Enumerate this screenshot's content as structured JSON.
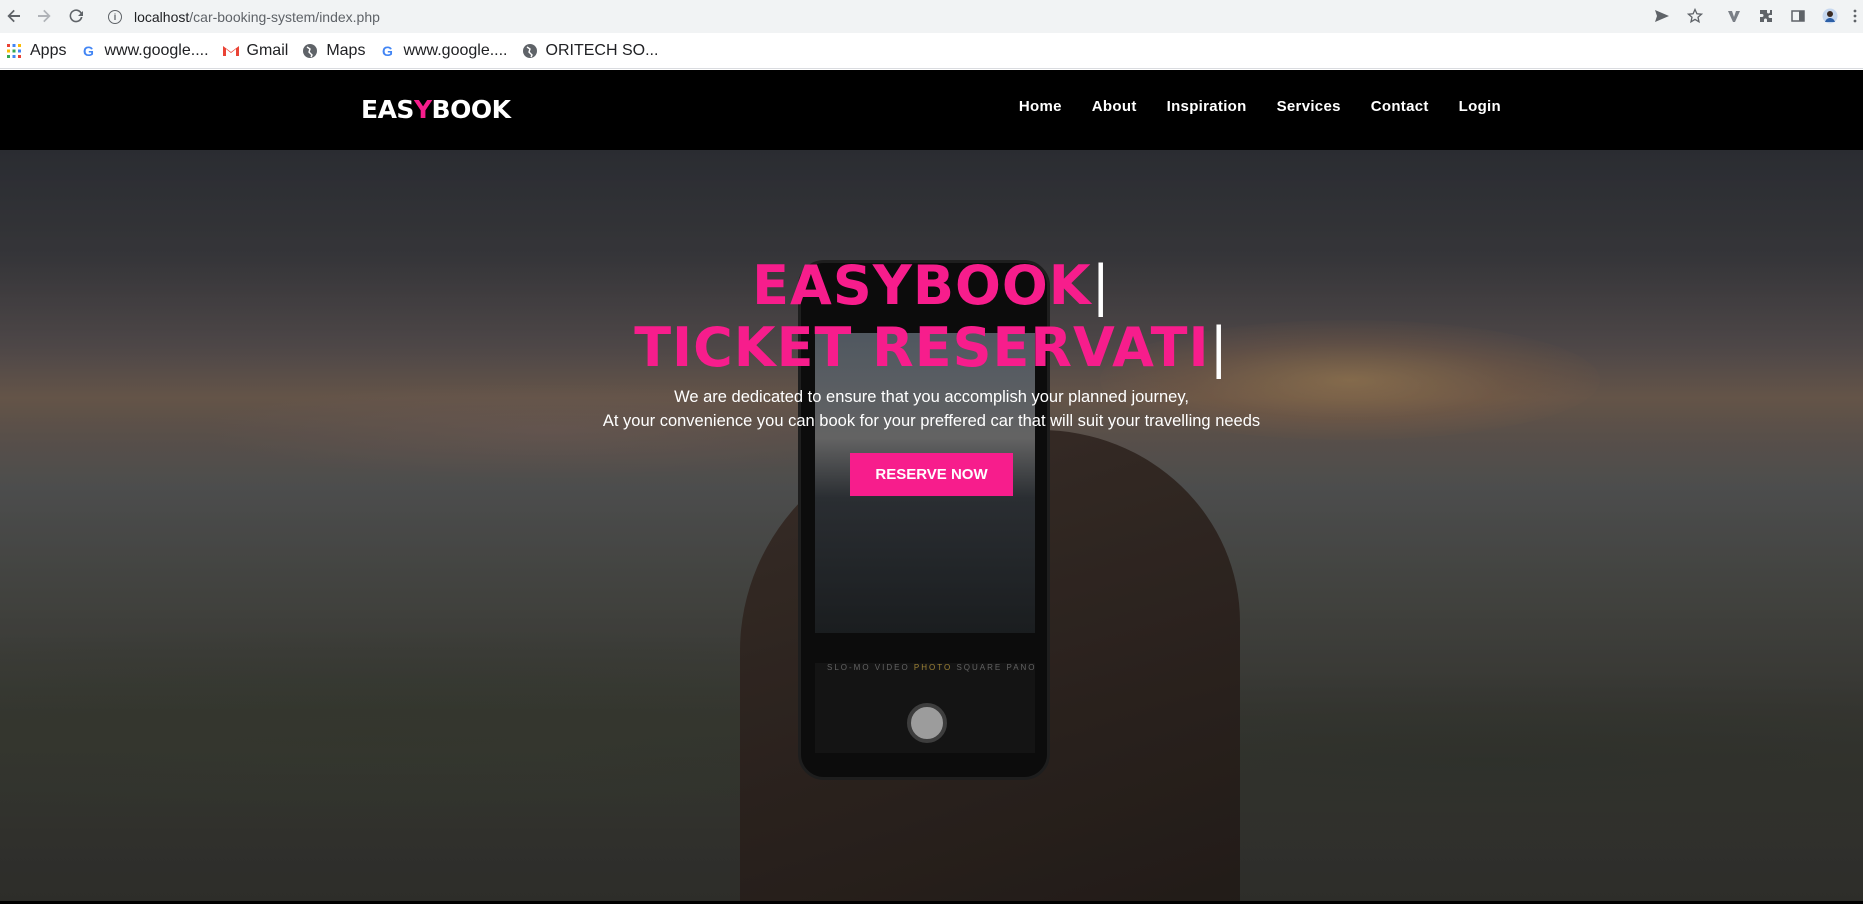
{
  "browser": {
    "url_host": "localhost",
    "url_path": "/car-booking-system/index.php",
    "bookmarks": [
      {
        "label": "Apps",
        "icon": "apps-grid-icon"
      },
      {
        "label": "www.google....",
        "icon": "google-icon"
      },
      {
        "label": "Gmail",
        "icon": "gmail-icon"
      },
      {
        "label": "Maps",
        "icon": "globe-icon"
      },
      {
        "label": "www.google....",
        "icon": "google-icon"
      },
      {
        "label": "ORITECH SO...",
        "icon": "globe-icon"
      }
    ]
  },
  "site": {
    "logo_part1": "EAS",
    "logo_accent": "Y",
    "logo_part2": "BOOK",
    "nav": [
      "Home",
      "About",
      "Inspiration",
      "Services",
      "Contact",
      "Login"
    ]
  },
  "hero": {
    "headline_line1": "EASYBOOK",
    "headline_line2": "TICKET RESERVATI",
    "cursor": "|",
    "tagline_line1": "We are dedicated to ensure that you accomplish your planned journey,",
    "tagline_line2": "At your convenience you can book for your preffered car that will suit your travelling needs",
    "cta_label": "RESERVE NOW",
    "phone_modes_pre": "SLO-MO  VIDEO ",
    "phone_modes_active": "PHOTO",
    "phone_modes_post": " SQUARE  PANO"
  },
  "colors": {
    "accent": "#f71d8c",
    "header_bg": "#000000"
  }
}
